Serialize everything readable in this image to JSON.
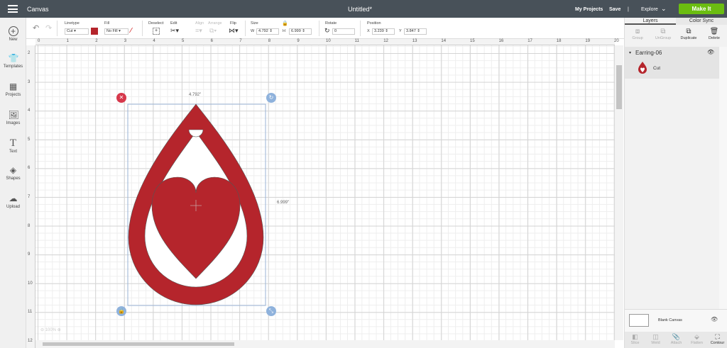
{
  "topbar": {
    "app": "Canvas",
    "title": "Untitled*",
    "my_projects": "My Projects",
    "save": "Save",
    "divider": "|",
    "explore": "Explore",
    "make_it": "Make It"
  },
  "sidebar": [
    {
      "label": "New",
      "icon": "plus-icon"
    },
    {
      "label": "Templates",
      "icon": "shirt-icon"
    },
    {
      "label": "Projects",
      "icon": "projects-icon"
    },
    {
      "label": "Images",
      "icon": "image-icon"
    },
    {
      "label": "Text",
      "icon": "text-icon"
    },
    {
      "label": "Shapes",
      "icon": "shapes-icon"
    },
    {
      "label": "Upload",
      "icon": "upload-icon"
    }
  ],
  "toolbar": {
    "linetype_label": "Linetype",
    "linetype": "Cut",
    "fill_label": "Fill",
    "fill": "No Fill",
    "deselect": "Deselect",
    "edit": "Edit",
    "align": "Align",
    "arrange": "Arrange",
    "flip": "Flip",
    "size_label": "Size",
    "w_label": "W",
    "w": "4.792",
    "h_label": "H",
    "h": "6.999",
    "rotate_label": "Rotate",
    "rotate": "0",
    "position_label": "Position",
    "x_label": "X",
    "x": "3.239",
    "y_label": "Y",
    "y": "3.847",
    "color": "#b5252c"
  },
  "rulers": {
    "h": [
      "0",
      "1",
      "2",
      "3",
      "4",
      "5",
      "6",
      "7",
      "8",
      "9",
      "10",
      "11",
      "12",
      "13",
      "14",
      "15",
      "16",
      "17",
      "18",
      "19",
      "20"
    ],
    "v": [
      "2",
      "3",
      "4",
      "5",
      "6",
      "7",
      "8",
      "9",
      "10",
      "11",
      "12"
    ]
  },
  "canvas": {
    "width_label": "4.792\"",
    "height_label": "6.999\"",
    "zoom": "100%"
  },
  "right": {
    "tabs": [
      "Layers",
      "Color Sync"
    ],
    "actions": [
      "Group",
      "UnGroup",
      "Duplicate",
      "Delete"
    ],
    "group": "Earring-06",
    "layer": "Cut",
    "blank_canvas": "Blank Canvas",
    "bottom": [
      "Slice",
      "Weld",
      "Attach",
      "Flatten",
      "Contour"
    ]
  }
}
